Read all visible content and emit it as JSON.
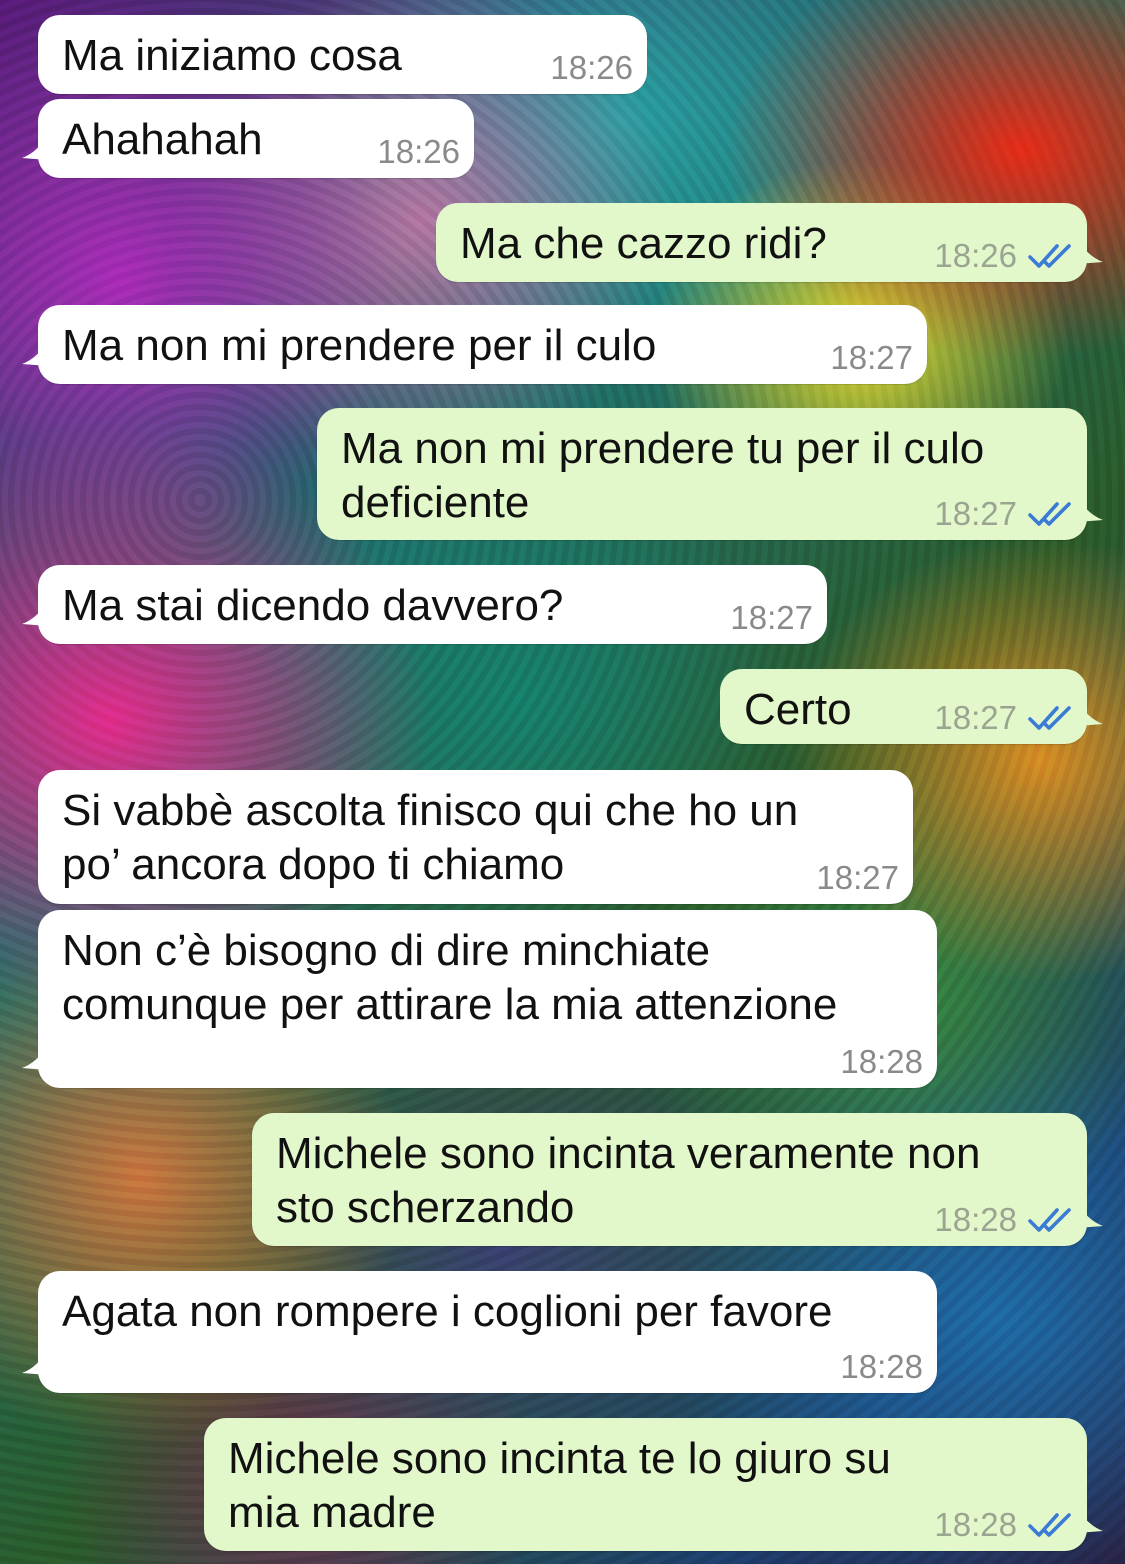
{
  "colors": {
    "incoming_bubble": "#ffffff",
    "outgoing_bubble": "#e2f8cb",
    "read_ticks": "#3a7bd5",
    "time_text": "#8a8a8a"
  },
  "messages": [
    {
      "direction": "in",
      "text": "Ma iniziamo cosa",
      "time": "18:26",
      "tail": false
    },
    {
      "direction": "in",
      "text": "Ahahahah",
      "time": "18:26",
      "tail": true
    },
    {
      "direction": "out",
      "text": "Ma che cazzo ridi?",
      "time": "18:26",
      "read": true,
      "tail": true
    },
    {
      "direction": "in",
      "text": "Ma non mi prendere per il culo",
      "time": "18:27",
      "tail": true
    },
    {
      "direction": "out",
      "text": "Ma non mi prendere tu per il culo\ndeficiente",
      "time": "18:27",
      "read": true,
      "tail": true
    },
    {
      "direction": "in",
      "text": "Ma stai dicendo davvero?",
      "time": "18:27",
      "tail": true
    },
    {
      "direction": "out",
      "text": "Certo",
      "time": "18:27",
      "read": true,
      "tail": true
    },
    {
      "direction": "in",
      "text": "Si vabbè ascolta finisco qui che ho un\npo’ ancora dopo ti chiamo",
      "time": "18:27",
      "tail": false
    },
    {
      "direction": "in",
      "text": "Non c’è bisogno di dire minchiate\ncomunque per attirare la mia attenzione",
      "time": "18:28",
      "tail": true
    },
    {
      "direction": "out",
      "text": "Michele sono incinta veramente non\nsto scherzando",
      "time": "18:28",
      "read": true,
      "tail": true
    },
    {
      "direction": "in",
      "text": "Agata non rompere i coglioni per favore",
      "time": "18:28",
      "tail": true
    },
    {
      "direction": "out",
      "text": "Michele sono incinta te lo giuro su\nmia madre",
      "time": "18:28",
      "read": true,
      "tail": true
    }
  ]
}
